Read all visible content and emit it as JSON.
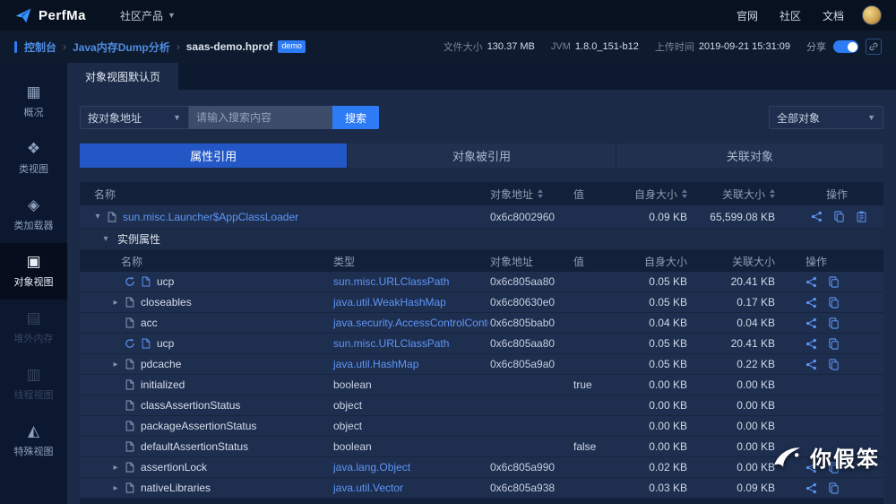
{
  "topbar": {
    "brand": "PerfMa",
    "nav_product": "社区产品",
    "links": [
      "官网",
      "社区",
      "文档"
    ]
  },
  "breadcrumb": {
    "console": "控制台",
    "section": "Java内存Dump分析",
    "file": "saas-demo.hprof",
    "badge": "demo",
    "meta": [
      {
        "label": "文件大小",
        "value": "130.37 MB"
      },
      {
        "label": "JVM",
        "value": "1.8.0_151-b12"
      },
      {
        "label": "上传时间",
        "value": "2019-09-21 15:31:09"
      }
    ],
    "share_label": "分享"
  },
  "sidebar": [
    {
      "label": "概况",
      "icon": "overview-icon",
      "state": "normal"
    },
    {
      "label": "类视图",
      "icon": "class-view-icon",
      "state": "normal"
    },
    {
      "label": "类加载器",
      "icon": "class-loader-icon",
      "state": "normal"
    },
    {
      "label": "对象视图",
      "icon": "object-view-icon",
      "state": "active"
    },
    {
      "label": "堆外内存",
      "icon": "offheap-memory-icon",
      "state": "disabled"
    },
    {
      "label": "线程视图",
      "icon": "thread-view-icon",
      "state": "disabled"
    },
    {
      "label": "特殊视图",
      "icon": "special-view-icon",
      "state": "normal"
    }
  ],
  "content": {
    "page_tab": "对象视图默认页",
    "search": {
      "mode": "按对象地址",
      "placeholder": "请输入搜索内容",
      "button": "搜索",
      "scope": "全部对象"
    },
    "tabs": [
      {
        "label": "属性引用",
        "active": true
      },
      {
        "label": "对象被引用",
        "active": false
      },
      {
        "label": "关联对象",
        "active": false
      }
    ],
    "outer_table": {
      "headers": [
        {
          "label": "名称",
          "sortable": false
        },
        {
          "label": "对象地址",
          "sortable": true
        },
        {
          "label": "值",
          "sortable": false
        },
        {
          "label": "自身大小",
          "sortable": true
        },
        {
          "label": "关联大小",
          "sortable": true
        },
        {
          "label": "操作",
          "sortable": false
        }
      ],
      "row": {
        "name": "sun.misc.Launcher$AppClassLoader",
        "address": "0x6c8002960",
        "value": "",
        "self_size": "0.09 KB",
        "retained_size": "65,599.08 KB",
        "ops": [
          "ref-graph-icon",
          "copy-icon",
          "clipboard-icon"
        ]
      }
    },
    "section_label": "实例属性",
    "inner_table": {
      "headers": [
        {
          "label": "名称",
          "sortable": false
        },
        {
          "label": "类型",
          "sortable": false
        },
        {
          "label": "对象地址",
          "sortable": false
        },
        {
          "label": "值",
          "sortable": false
        },
        {
          "label": "自身大小",
          "sortable": false
        },
        {
          "label": "关联大小",
          "sortable": false
        },
        {
          "label": "操作",
          "sortable": false
        }
      ],
      "rows": [
        {
          "lead": "loop",
          "name": "ucp",
          "type": "sun.misc.URLClassPath",
          "type_link": true,
          "address": "0x6c805aa80",
          "value": "",
          "self_size": "0.05 KB",
          "retained_size": "20.41 KB",
          "ops": [
            "ref-graph-icon",
            "copy-icon"
          ]
        },
        {
          "lead": "caret",
          "name": "closeables",
          "type": "java.util.WeakHashMap",
          "type_link": true,
          "address": "0x6c80630e0",
          "value": "",
          "self_size": "0.05 KB",
          "retained_size": "0.17 KB",
          "ops": [
            "ref-graph-icon",
            "copy-icon"
          ]
        },
        {
          "lead": "doc",
          "name": "acc",
          "type": "java.security.AccessControlContext",
          "type_link": true,
          "address": "0x6c805bab0",
          "value": "",
          "self_size": "0.04 KB",
          "retained_size": "0.04 KB",
          "ops": [
            "ref-graph-icon",
            "copy-icon"
          ]
        },
        {
          "lead": "loop",
          "name": "ucp",
          "type": "sun.misc.URLClassPath",
          "type_link": true,
          "address": "0x6c805aa80",
          "value": "",
          "self_size": "0.05 KB",
          "retained_size": "20.41 KB",
          "ops": [
            "ref-graph-icon",
            "copy-icon"
          ]
        },
        {
          "lead": "caret",
          "name": "pdcache",
          "type": "java.util.HashMap",
          "type_link": true,
          "address": "0x6c805a9a0",
          "value": "",
          "self_size": "0.05 KB",
          "retained_size": "0.22 KB",
          "ops": [
            "ref-graph-icon",
            "copy-icon"
          ]
        },
        {
          "lead": "doc",
          "name": "initialized",
          "type": "boolean",
          "type_link": false,
          "address": "",
          "value": "true",
          "self_size": "0.00 KB",
          "retained_size": "0.00 KB",
          "ops": []
        },
        {
          "lead": "doc",
          "name": "classAssertionStatus",
          "type": "object",
          "type_link": false,
          "address": "",
          "value": "",
          "self_size": "0.00 KB",
          "retained_size": "0.00 KB",
          "ops": []
        },
        {
          "lead": "doc",
          "name": "packageAssertionStatus",
          "type": "object",
          "type_link": false,
          "address": "",
          "value": "",
          "self_size": "0.00 KB",
          "retained_size": "0.00 KB",
          "ops": []
        },
        {
          "lead": "doc",
          "name": "defaultAssertionStatus",
          "type": "boolean",
          "type_link": false,
          "address": "",
          "value": "false",
          "self_size": "0.00 KB",
          "retained_size": "0.00 KB",
          "ops": []
        },
        {
          "lead": "caret",
          "name": "assertionLock",
          "type": "java.lang.Object",
          "type_link": true,
          "address": "0x6c805a990",
          "value": "",
          "self_size": "0.02 KB",
          "retained_size": "0.00 KB",
          "ops": [
            "ref-graph-icon",
            "copy-icon"
          ]
        },
        {
          "lead": "caret",
          "name": "nativeLibraries",
          "type": "java.util.Vector",
          "type_link": true,
          "address": "0x6c805a938",
          "value": "",
          "self_size": "0.03 KB",
          "retained_size": "0.09 KB",
          "ops": [
            "ref-graph-icon",
            "copy-icon"
          ]
        }
      ]
    }
  },
  "watermark": "你假笨",
  "colors": {
    "accent": "#2e7bf6",
    "link": "#5e96f7"
  }
}
